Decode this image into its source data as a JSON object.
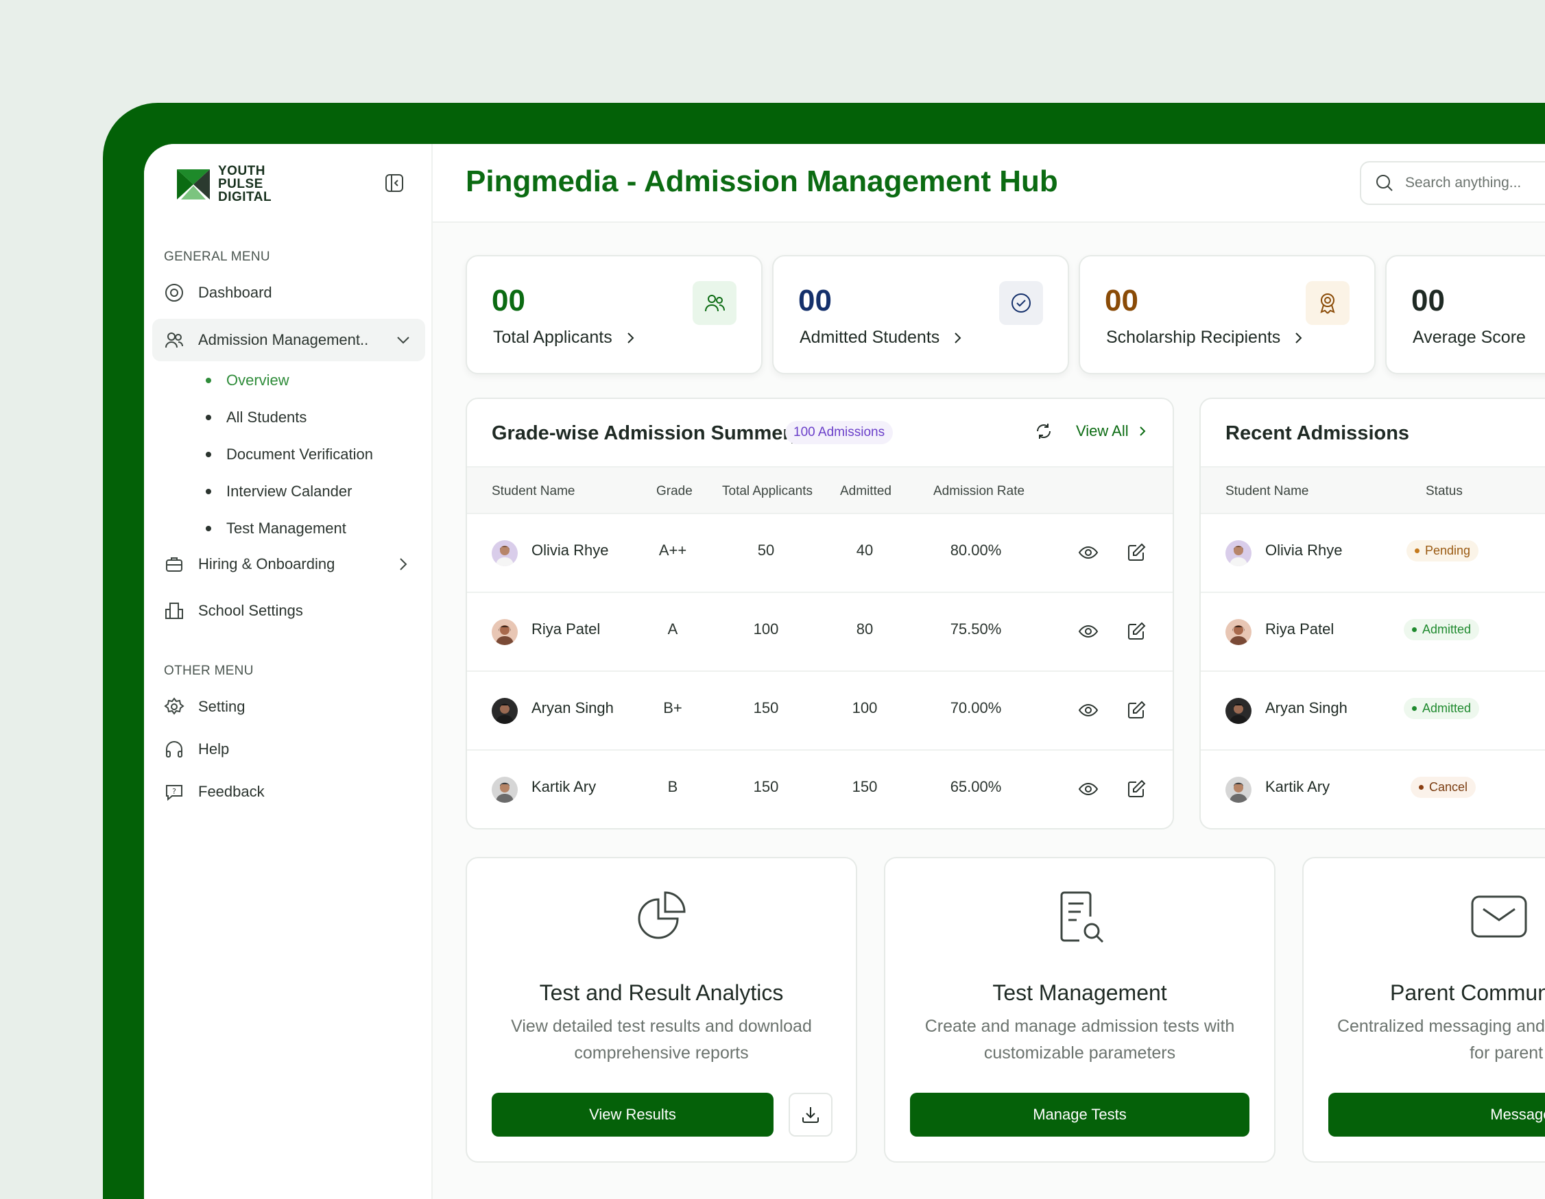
{
  "app": {
    "logo_lines": [
      "YOUTH",
      "PULSE",
      "DIGITAL"
    ],
    "title": "Pingmedia - Admission Management Hub"
  },
  "search": {
    "placeholder": "Search anything..."
  },
  "sidebar": {
    "general_title": "GENERAL MENU",
    "other_title": "OTHER MENU",
    "items": [
      {
        "label": "Dashboard",
        "icon": "compass-icon"
      },
      {
        "label": "Admission Management..",
        "icon": "users-icon"
      },
      {
        "label": "Hiring & Onboarding",
        "icon": "briefcase-icon"
      },
      {
        "label": "School Settings",
        "icon": "building-icon"
      }
    ],
    "sub_items": [
      "Overview",
      "All Students",
      "Document Verification",
      "Interview Calander",
      "Test Management"
    ],
    "other_items": [
      {
        "label": "Setting",
        "icon": "gear-icon"
      },
      {
        "label": "Help",
        "icon": "headphones-icon"
      },
      {
        "label": "Feedback",
        "icon": "feedback-icon"
      }
    ]
  },
  "stats": [
    {
      "value": "00",
      "label": "Total Applicants",
      "color": "#0b6b12",
      "icon": "users-icon",
      "icon_bg": "#e9f6ea"
    },
    {
      "value": "00",
      "label": "Admitted Students",
      "color": "#14306b",
      "icon": "check-circle-icon",
      "icon_bg": "#eef0f4"
    },
    {
      "value": "00",
      "label": "Scholarship Recipients",
      "color": "#8a4b07",
      "icon": "award-icon",
      "icon_bg": "#fbf3e6"
    },
    {
      "value": "00",
      "label": "Average Score",
      "color": "#1f2a24"
    }
  ],
  "grade_summary": {
    "title": "Grade-wise Admission Summery",
    "badge": "100 Admissions",
    "view_all": "View All",
    "columns": [
      "Student Name",
      "Grade",
      "Total Applicants",
      "Admitted",
      "Admission Rate"
    ],
    "rows": [
      {
        "name": "Olivia Rhye",
        "grade": "A++",
        "total": "50",
        "admitted": "40",
        "rate": "80.00%"
      },
      {
        "name": "Riya Patel",
        "grade": "A",
        "total": "100",
        "admitted": "80",
        "rate": "75.50%"
      },
      {
        "name": "Aryan Singh",
        "grade": "B+",
        "total": "150",
        "admitted": "100",
        "rate": "70.00%"
      },
      {
        "name": "Kartik Ary",
        "grade": "B",
        "total": "150",
        "admitted": "150",
        "rate": "65.00%"
      }
    ]
  },
  "recent": {
    "title": "Recent Admissions",
    "columns": [
      "Student Name",
      "Status"
    ],
    "rows": [
      {
        "name": "Olivia Rhye",
        "status": "Pending",
        "kind": "pending"
      },
      {
        "name": "Riya Patel",
        "status": "Admitted",
        "kind": "admitted"
      },
      {
        "name": "Aryan Singh",
        "status": "Admitted",
        "kind": "admitted"
      },
      {
        "name": "Kartik Ary",
        "status": "Cancel",
        "kind": "cancel"
      }
    ]
  },
  "features": [
    {
      "title": "Test and Result Analytics",
      "desc": "View detailed test results and download comprehensive reports",
      "button": "View Results",
      "icon": "pie-chart-icon"
    },
    {
      "title": "Test Management",
      "desc": "Create and manage admission tests with customizable parameters",
      "button": "Manage Tests",
      "icon": "document-search-icon"
    },
    {
      "title": "Parent Communi",
      "desc": "Centralized messaging and c hub for parent Intera",
      "button": "Message Hub",
      "icon": "mail-icon"
    }
  ]
}
